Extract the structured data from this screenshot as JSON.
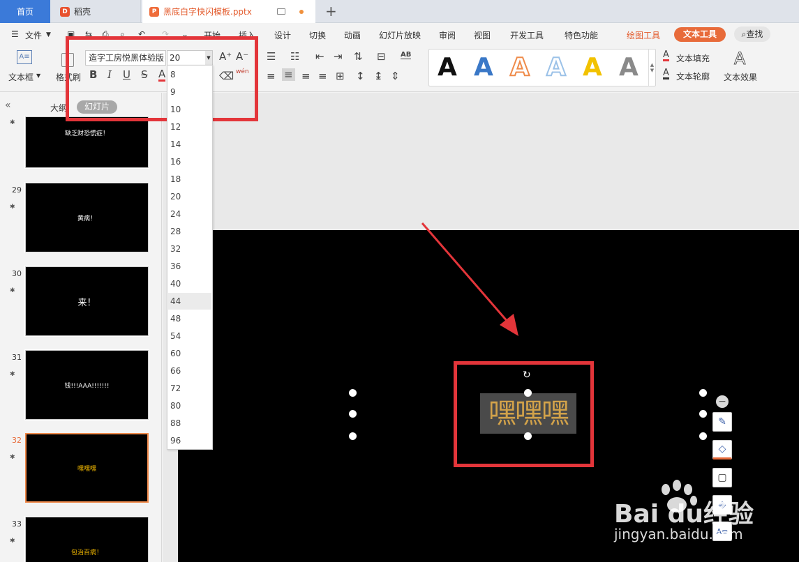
{
  "tabs": {
    "home": "首页",
    "docer": "稻壳",
    "file": "黑底白字快闪模板.pptx",
    "add": "+"
  },
  "menu": {
    "file": "文件",
    "items": [
      "开始",
      "插入",
      "设计",
      "切换",
      "动画",
      "幻灯片放映",
      "审阅",
      "视图",
      "开发工具",
      "特色功能"
    ],
    "drawing_tools": "绘图工具",
    "text_tools": "文本工具",
    "search": "查找"
  },
  "ribbon": {
    "textbox_label": "文本框",
    "format_painter_label": "格式刷",
    "font_name": "造字工房悦黑体验版",
    "font_size": "20",
    "bold": "B",
    "italic": "I",
    "underline": "U",
    "strike": "S",
    "font_color": "A",
    "grow_font": "A⁺",
    "shrink_font": "A⁻",
    "phonetic": "wén",
    "text_fill": "文本填充",
    "text_outline": "文本轮廓",
    "text_effect": "文本效果",
    "style_glyph": "A",
    "style_colors": [
      "#111111",
      "#3a78c7",
      "#ef8b4a",
      "#9cc2e8",
      "#f2c200",
      "#8a8a8a"
    ]
  },
  "panel": {
    "outline_tab": "大纲",
    "slides_tab": "幻灯片"
  },
  "slides": [
    {
      "num": "",
      "text": "缺乏财恐慌症！",
      "color": "#ffffff"
    },
    {
      "num": "29",
      "text": "黄病！",
      "color": "#ffffff"
    },
    {
      "num": "30",
      "text": "来！",
      "color": "#ffffff"
    },
    {
      "num": "31",
      "text": "钱!!!AAA!!!!!!!",
      "color": "#ffffff"
    },
    {
      "num": "32",
      "text": "嘿嘿嘿",
      "color": "#f2b800"
    },
    {
      "num": "33",
      "text": "包治百病！",
      "color": "#f2b800"
    }
  ],
  "font_sizes": [
    "8",
    "9",
    "10",
    "12",
    "14",
    "16",
    "18",
    "20",
    "24",
    "28",
    "32",
    "36",
    "40",
    "44",
    "48",
    "54",
    "60",
    "66",
    "72",
    "80",
    "88",
    "96"
  ],
  "highlighted_size": "44",
  "slide_text": "嘿嘿嘿",
  "watermark": {
    "logo": "Bai  du经验",
    "url": "jingyan.baidu.com"
  },
  "colors": {
    "accent": "#e86b3a",
    "annotation": "#e3353a",
    "home_tab": "#3b7ad9",
    "text_gold": "#d2a24a"
  }
}
